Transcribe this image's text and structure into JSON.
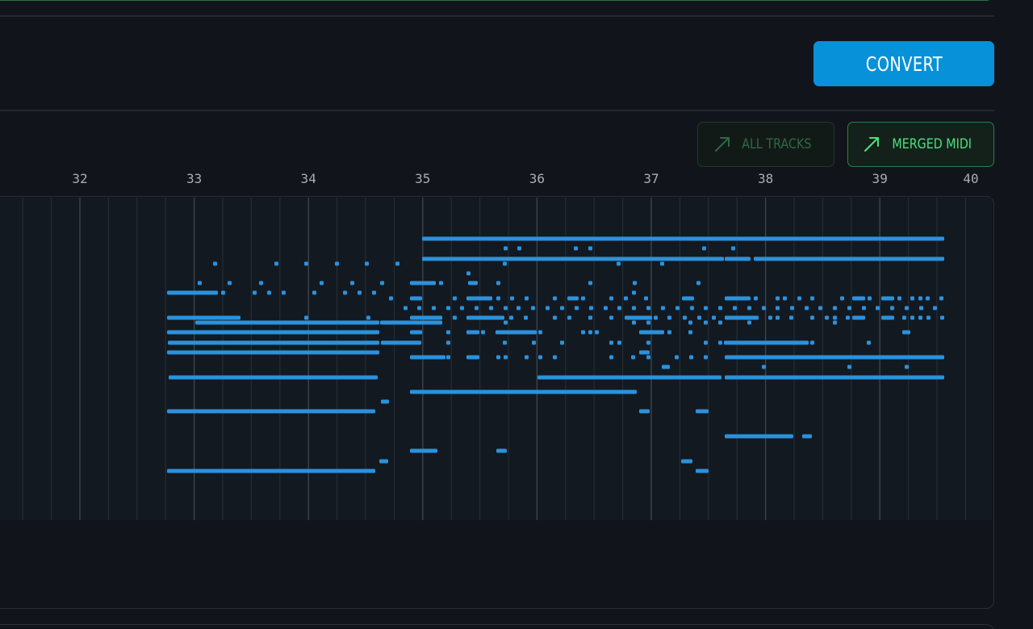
{
  "toolbar": {
    "convert_label": "CONVERT"
  },
  "view_buttons": {
    "all_tracks_label": "ALL TRACKS",
    "merged_midi_label": "MERGED MIDI"
  },
  "piano_roll": {
    "measures": [
      "32",
      "33",
      "34",
      "35",
      "36",
      "37",
      "38",
      "39",
      "40"
    ],
    "note_color": "#2a92de",
    "grid_strong_color": "#3c434c",
    "grid_weak_color": "#262c34"
  },
  "colors": {
    "accent": "#0791d9",
    "active_green": "#4ee07d",
    "inactive_green": "#2e6a43"
  }
}
